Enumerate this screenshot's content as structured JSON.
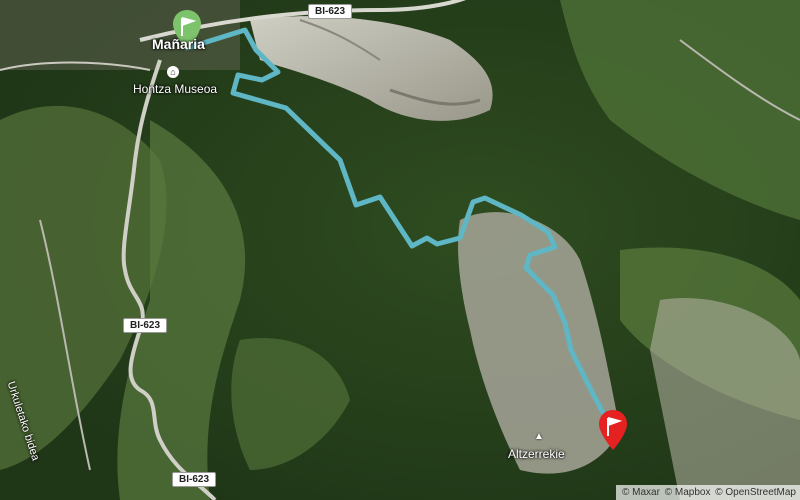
{
  "map": {
    "labels": {
      "town": "Mañaria",
      "museum": "Hontza Museoa",
      "peak": "Altzerrekie",
      "street": "Urkuletako bidea"
    },
    "roads": [
      "BI-623",
      "BI-623",
      "BI-623"
    ],
    "attribution": [
      "© Maxar",
      "© Mapbox",
      "© OpenStreetMap"
    ],
    "route_color": "#5fb6c4",
    "start_marker_color": "#7cc36c",
    "end_marker_color": "#e52121"
  }
}
